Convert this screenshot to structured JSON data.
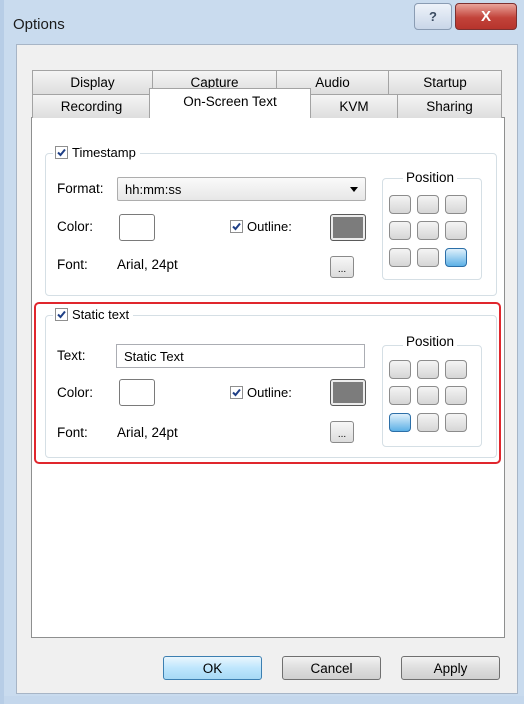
{
  "window": {
    "title": "Options",
    "help_label": "?",
    "close_label": "X"
  },
  "tabs_row1": [
    "Display",
    "Capture",
    "Audio",
    "Startup"
  ],
  "tabs_row2": [
    "Recording",
    "On-Screen Text",
    "KVM",
    "Sharing"
  ],
  "active_tab": "On-Screen Text",
  "timestamp_group": {
    "title": "Timestamp",
    "checked": true,
    "format_label": "Format:",
    "format_value": "hh:mm:ss",
    "color_label": "Color:",
    "color_value": "#ffffff",
    "outline_label": "Outline:",
    "outline_checked": true,
    "outline_color": "#7c7c7c",
    "font_label": "Font:",
    "font_value": "Arial, 24pt",
    "browse_label": "...",
    "position_label": "Position",
    "selected_position": "bottom-right"
  },
  "static_group": {
    "title": "Static text",
    "checked": true,
    "text_label": "Text:",
    "text_value": "Static Text",
    "color_label": "Color:",
    "color_value": "#ffffff",
    "outline_label": "Outline:",
    "outline_checked": true,
    "outline_color": "#7c7c7c",
    "font_label": "Font:",
    "font_value": "Arial, 24pt",
    "browse_label": "...",
    "position_label": "Position",
    "selected_position": "bottom-left"
  },
  "highlight_color": "#e0262d",
  "buttons": {
    "ok": "OK",
    "cancel": "Cancel",
    "apply": "Apply"
  }
}
